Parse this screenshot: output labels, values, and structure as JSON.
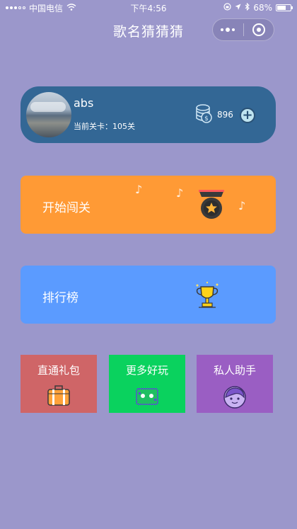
{
  "status_bar": {
    "carrier": "中国电信",
    "time": "下午4:56",
    "battery": "68%",
    "battery_level": 0.68
  },
  "nav": {
    "title": "歌名猜猜猜"
  },
  "user": {
    "name": "abs",
    "level_text": "当前关卡：105关",
    "coins": "896"
  },
  "menu": {
    "start_label": "开始闯关",
    "rank_label": "排行榜",
    "note_symbol": "♪"
  },
  "tiles": [
    {
      "label": "直通礼包",
      "icon": "gift-box-icon"
    },
    {
      "label": "更多好玩",
      "icon": "game-controller-icon"
    },
    {
      "label": "私人助手",
      "icon": "assistant-face-icon"
    }
  ],
  "colors": {
    "background": "#9b97cb",
    "user_card": "#336795",
    "start": "#ff9a35",
    "rank": "#5b9bff",
    "gift": "#cf6567",
    "more": "#0ad25e",
    "assistant": "#9a5ec3"
  }
}
